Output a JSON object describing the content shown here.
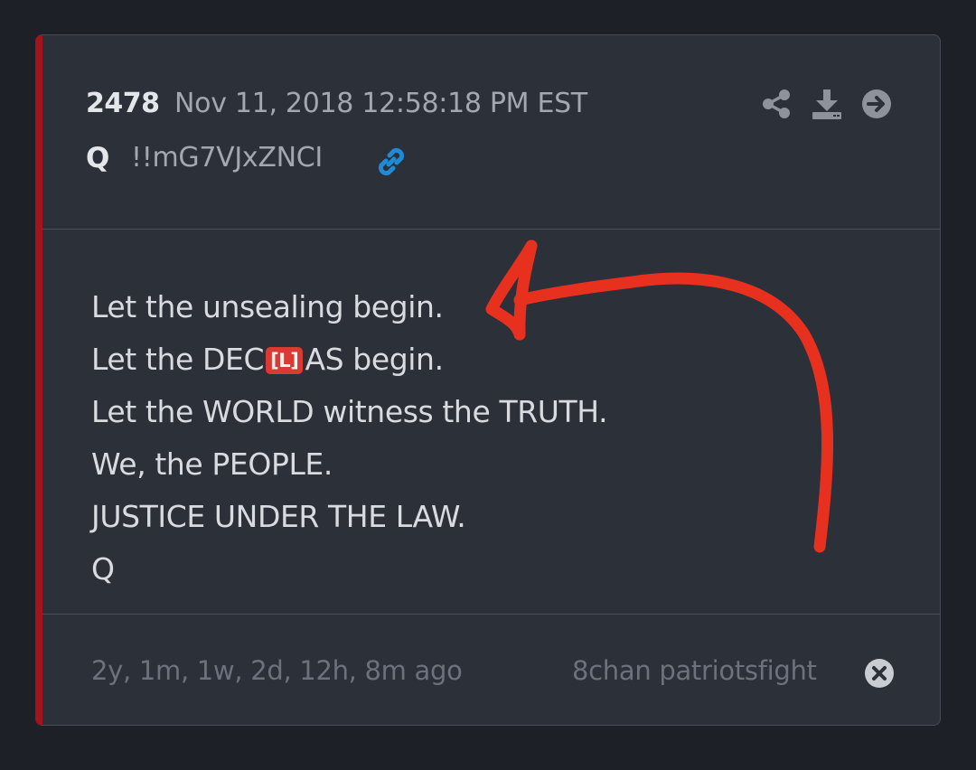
{
  "post": {
    "number": "2478",
    "date": "Nov 11, 2018 12:58:18 PM EST",
    "author": "Q",
    "tripcode": "!!mG7VJxZNCI",
    "lines": [
      "Let the unsealing begin.",
      "Let the DEC",
      "AS begin.",
      "Let the WORLD witness the TRUTH.",
      "We, the PEOPLE.",
      "JUSTICE UNDER THE LAW.",
      "Q"
    ],
    "redaction_badge": "[L]"
  },
  "footer": {
    "time_ago": "2y, 1m, 1w, 2d, 12h, 8m ago",
    "source": "8chan patriotsfight"
  },
  "icons": {
    "link": "link-icon",
    "share": "share-icon",
    "download": "download-icon",
    "goto": "arrow-right-circle-icon",
    "close": "close-circle-icon"
  },
  "colors": {
    "background": "#1e2027",
    "card": "#2c3038",
    "accent_border": "#a3131b",
    "link_blue": "#1f8ad6",
    "badge_red": "#d93a32",
    "annotation_red": "#e8301f"
  }
}
